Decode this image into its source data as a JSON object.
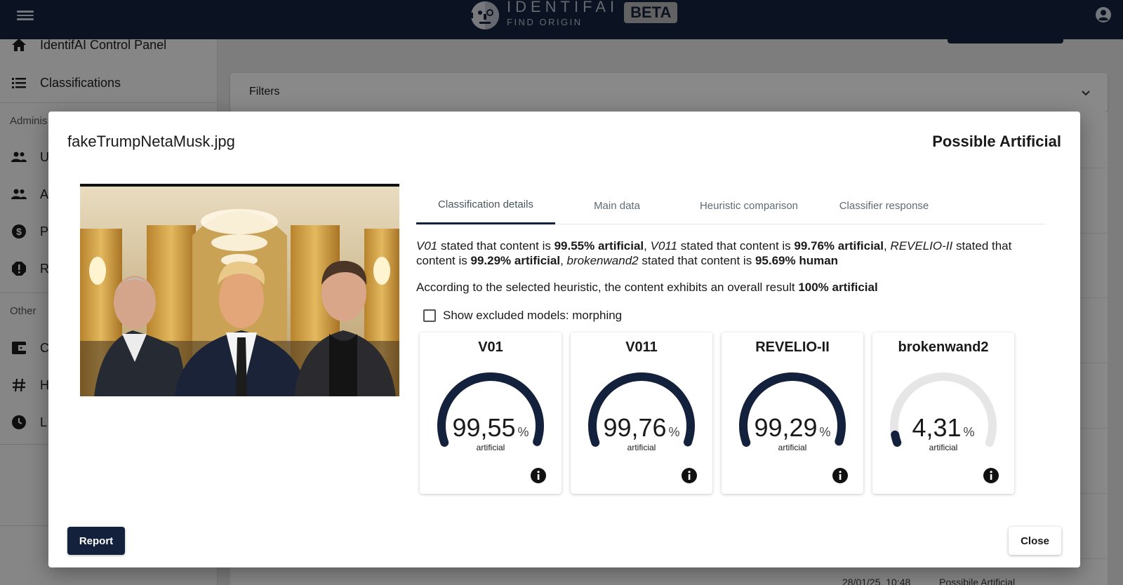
{
  "header": {
    "brand_name": "IDENTIFAI",
    "brand_tagline": "FIND ORIGIN",
    "beta_label": "BETA"
  },
  "sidebar": {
    "items": [
      {
        "label": "IdentifAI Control Panel",
        "icon": "home-icon"
      },
      {
        "label": "Classifications",
        "icon": "list-icon"
      }
    ],
    "section_admin": "Adminis",
    "admin_items": [
      {
        "label": "U",
        "icon": "people-icon"
      },
      {
        "label": "A",
        "icon": "people-icon"
      },
      {
        "label": "P",
        "icon": "dollar-icon"
      },
      {
        "label": "R",
        "icon": "alert-icon"
      }
    ],
    "section_other": "Other",
    "other_items": [
      {
        "label": "C",
        "icon": "wallet-icon"
      },
      {
        "label": "H",
        "icon": "hash-icon"
      },
      {
        "label": "L",
        "icon": "clock-icon"
      }
    ]
  },
  "main": {
    "filters_label": "Filters",
    "bg_row_date": "28/01/25, 10:48",
    "bg_row_status": "Possibile Artificial"
  },
  "modal": {
    "title": "fakeTrumpNetaMusk.jpg",
    "verdict": "Possible Artificial",
    "tabs": [
      {
        "label": "Classification details",
        "active": true
      },
      {
        "label": "Main data",
        "active": false
      },
      {
        "label": "Heuristic comparison",
        "active": false
      },
      {
        "label": "Classifier response",
        "active": false
      }
    ],
    "details": {
      "m1": "V01",
      "t1": " stated that content is ",
      "v1": "99.55% artificial",
      "s1": ", ",
      "m2": "V011",
      "t2": " stated that content is ",
      "v2": "99.76% artificial",
      "s2": ", ",
      "m3": "REVELIO-II",
      "t3": " stated that content is ",
      "v3": "99.29% artificial",
      "s3": ", ",
      "m4": "brokenwand2",
      "t4": " stated that content is ",
      "v4": "95.69% human"
    },
    "heuristic_text": "According to the selected heuristic, the content exhibits an overall result ",
    "heuristic_result": "100% artificial",
    "show_excluded_label": "Show excluded models: morphing",
    "show_excluded_checked": false,
    "models": [
      {
        "name": "V01",
        "value": "99,55",
        "fraction": 0.9955,
        "unit": "%",
        "label": "artificial"
      },
      {
        "name": "V011",
        "value": "99,76",
        "fraction": 0.9976,
        "unit": "%",
        "label": "artificial"
      },
      {
        "name": "REVELIO-II",
        "value": "99,29",
        "fraction": 0.9929,
        "unit": "%",
        "label": "artificial"
      },
      {
        "name": "brokenwand2",
        "value": "4,31",
        "fraction": 0.0431,
        "unit": "%",
        "label": "artificial"
      }
    ],
    "report_label": "Report",
    "close_label": "Close"
  },
  "colors": {
    "primary": "#14213d",
    "gauge_track": "#e6e6e6"
  }
}
